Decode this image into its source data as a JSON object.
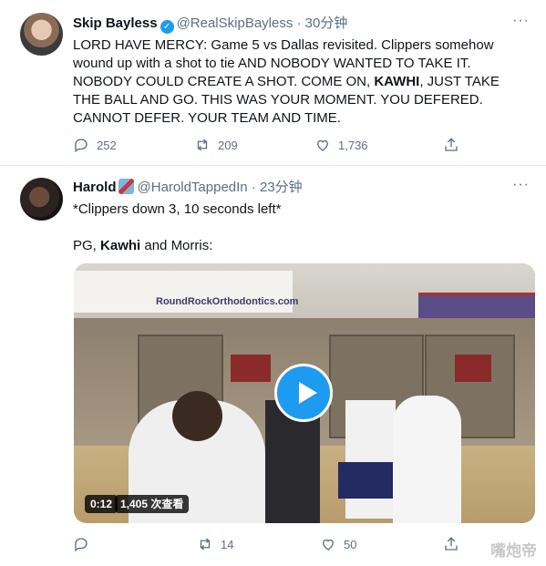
{
  "tweet1": {
    "name": "Skip Bayless",
    "handle": "@RealSkipBayless",
    "time": "· 30分钟",
    "text_pre": "LORD HAVE MERCY: Game 5 vs Dallas revisited. Clippers somehow wound up with a shot to tie AND NOBODY WANTED TO TAKE IT. NOBODY COULD CREATE A SHOT. COME ON, ",
    "text_bold": "KAWHI",
    "text_post": ", JUST TAKE THE BALL AND GO. THIS WAS YOUR MOMENT. YOU DEFERED. CANNOT DEFER. YOUR TEAM AND TIME.",
    "replies": "252",
    "retweets": "209",
    "likes": "1,736"
  },
  "tweet2": {
    "name": "Harold",
    "handle": "@HaroldTappedIn",
    "time": "· 23分钟",
    "line1": "*Clippers down 3, 10 seconds left*",
    "line2_pre": "PG, ",
    "line2_bold": "Kawhi",
    "line2_post": " and Morris:",
    "video": {
      "banner_text": "RoundRockOrthodontics.com",
      "time": "0:12",
      "views": "1,405 次查看"
    },
    "replies": "",
    "retweets": "14",
    "likes": "50"
  },
  "more_label": "···",
  "verified_mark": "✓",
  "watermark": "嘴炮帝",
  "colors": {
    "accent": "#1d9bf0",
    "secondary_text": "#5b7083"
  }
}
